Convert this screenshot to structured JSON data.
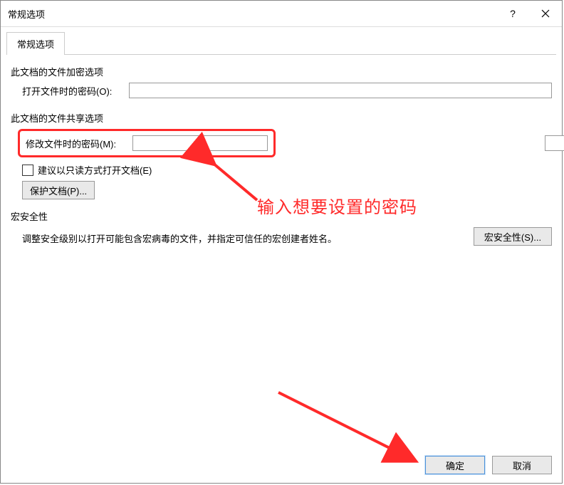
{
  "window": {
    "title": "常规选项"
  },
  "tabs": {
    "general": "常规选项"
  },
  "encrypt": {
    "section": "此文档的文件加密选项",
    "open_label": "打开文件时的密码(O):",
    "open_value": ""
  },
  "share": {
    "section": "此文档的文件共享选项",
    "modify_label": "修改文件时的密码(M):",
    "modify_value": "",
    "readonly_label": "建议以只读方式打开文档(E)",
    "readonly_checked": false,
    "protect_btn": "保护文档(P)..."
  },
  "macro": {
    "section": "宏安全性",
    "desc": "调整安全级别以打开可能包含宏病毒的文件，并指定可信任的宏创建者姓名。",
    "btn": "宏安全性(S)..."
  },
  "footer": {
    "ok": "确定",
    "cancel": "取消"
  },
  "annotation": {
    "text": "输入想要设置的密码"
  }
}
